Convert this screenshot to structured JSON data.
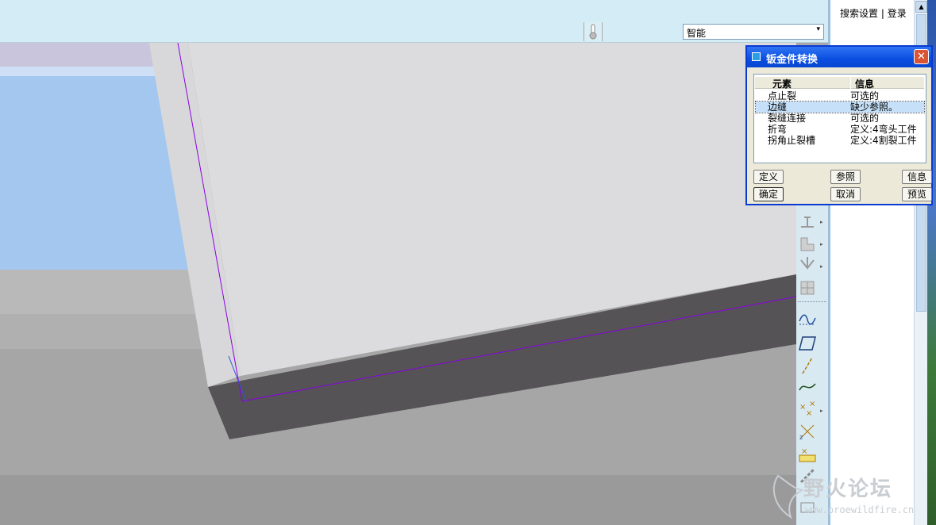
{
  "toolbar": {
    "filter_value": "智能",
    "filter_arrow": "▾",
    "thermometer_icon": "thermometer-icon"
  },
  "browser_panel": {
    "search_settings_link": "搜索设置",
    "separator": "|",
    "login_link": "登录"
  },
  "dialog": {
    "title": "钣金件转换",
    "close": "✕",
    "columns": [
      "元素",
      "信息"
    ],
    "rows": [
      {
        "element": "点止裂",
        "info": "可选的",
        "selected": false
      },
      {
        "element": "边缝",
        "info": "缺少参照。",
        "selected": true
      },
      {
        "element": "裂缝连接",
        "info": "可选的",
        "selected": false
      },
      {
        "element": "折弯",
        "info": "定义:4弯头工件",
        "selected": false
      },
      {
        "element": "拐角止裂槽",
        "info": "定义:4割裂工件",
        "selected": false
      }
    ],
    "buttons": {
      "define": "定义",
      "reference": "参照",
      "info": "信息",
      "ok": "确定",
      "cancel": "取消",
      "preview": "预览"
    }
  },
  "right_toolbar": {
    "icons": [
      "flange-icon",
      "bend-icon",
      "unbend-icon",
      "corner-relief-icon",
      "sketch-curve-icon",
      "datum-plane-icon",
      "datum-axis-icon",
      "datum-curve-icon",
      "datum-point-icon",
      "datum-point-offset-icon",
      "datum-point-field-icon",
      "chain-icon"
    ]
  },
  "watermark": {
    "text": "野火论坛",
    "url": "www.proewildfire.cn"
  },
  "colors": {
    "dialog_title": "#0a4ee0",
    "selection": "#c5e0f8",
    "edge_highlight": "#8000ff"
  }
}
